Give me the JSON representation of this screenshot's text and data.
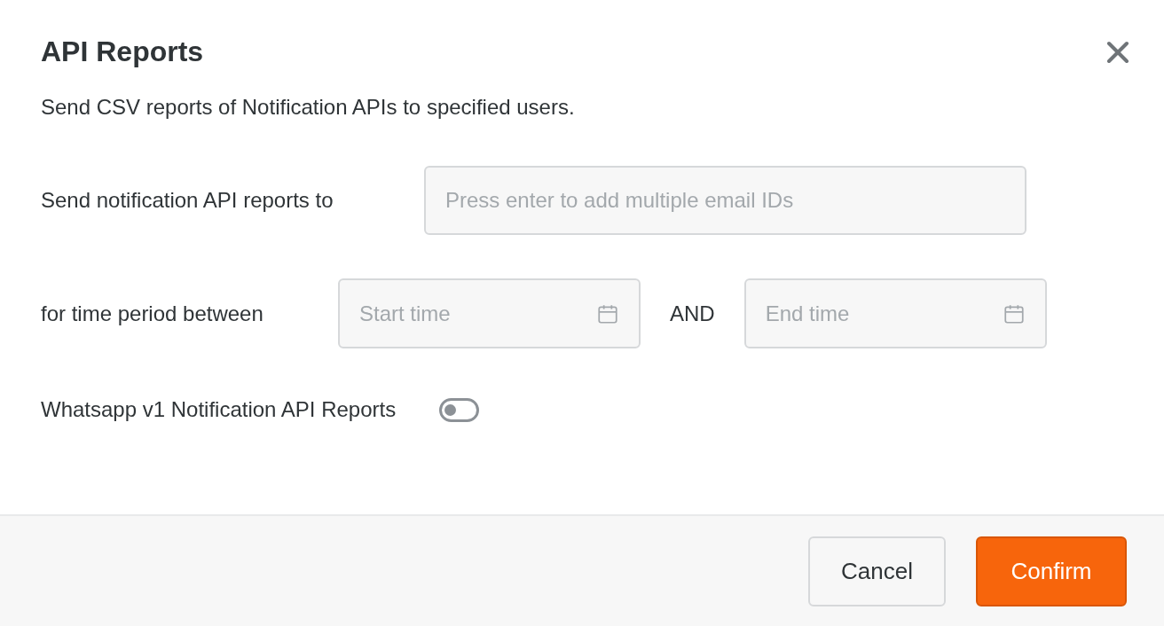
{
  "dialog": {
    "title": "API Reports",
    "description": "Send CSV reports of Notification APIs to specified users."
  },
  "recipients": {
    "label": "Send notification API reports to",
    "placeholder": "Press enter to add multiple email IDs"
  },
  "period": {
    "label": "for time period between",
    "start": {
      "placeholder": "Start time"
    },
    "joiner": "AND",
    "end": {
      "placeholder": "End time"
    }
  },
  "whatsapp": {
    "label": "Whatsapp v1 Notification API Reports",
    "on": false
  },
  "buttons": [
    {
      "label": "Cancel",
      "kind": "secondary"
    },
    {
      "label": "Confirm",
      "kind": "primary"
    }
  ]
}
